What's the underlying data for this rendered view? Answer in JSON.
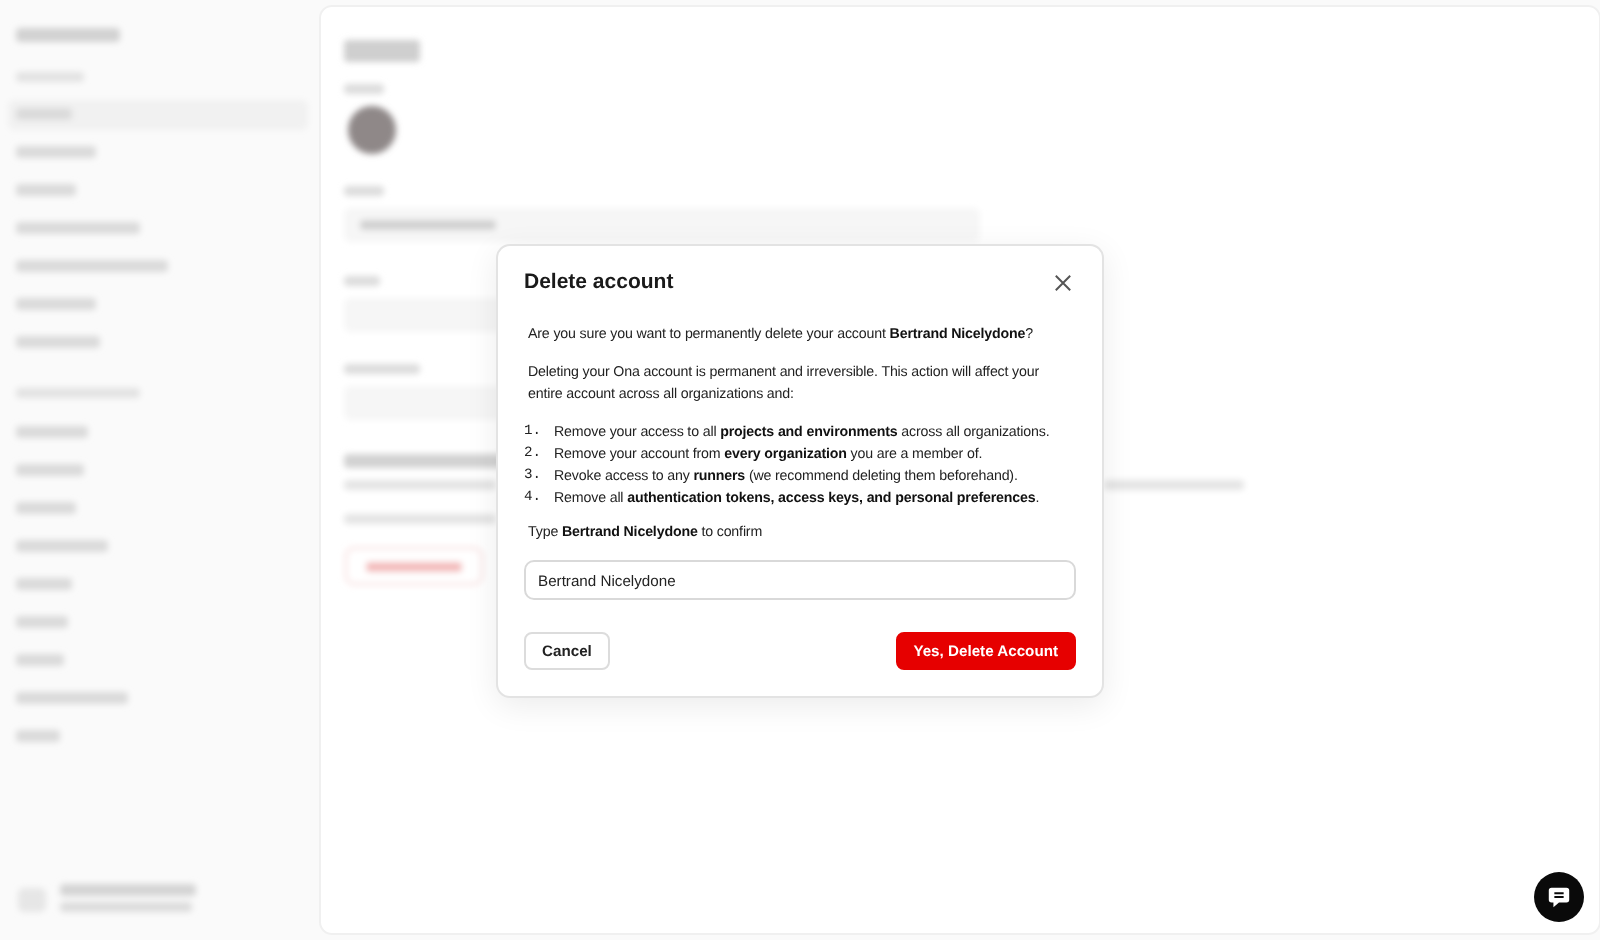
{
  "dialog": {
    "title": "Delete account",
    "question": "Are you sure you want to permanently delete your account **Bertrand Nicelydone**?",
    "warning": "Deleting your Ona account is permanent and irreversible. This action will affect your entire account across all organizations and:",
    "consequences": [
      {
        "number": "1.",
        "text": "Remove your access to all **projects and environments** across all organizations."
      },
      {
        "number": "2.",
        "text": "Remove your account from **every organization** you are a member of."
      },
      {
        "number": "3.",
        "text": "Revoke access to any **runners** (we recommend deleting them beforehand)."
      },
      {
        "number": "4.",
        "text": "Remove all **authentication tokens, access keys, and personal preferences**."
      }
    ],
    "confirm_label": "Type **Bertrand Nicelydone** to confirm",
    "confirm_field": {
      "value": "Bertrand Nicelydone"
    },
    "buttons": [
      {
        "label": "Cancel",
        "kind": "secondary"
      },
      {
        "label": "Yes, Delete Account",
        "kind": "danger"
      }
    ]
  }
}
